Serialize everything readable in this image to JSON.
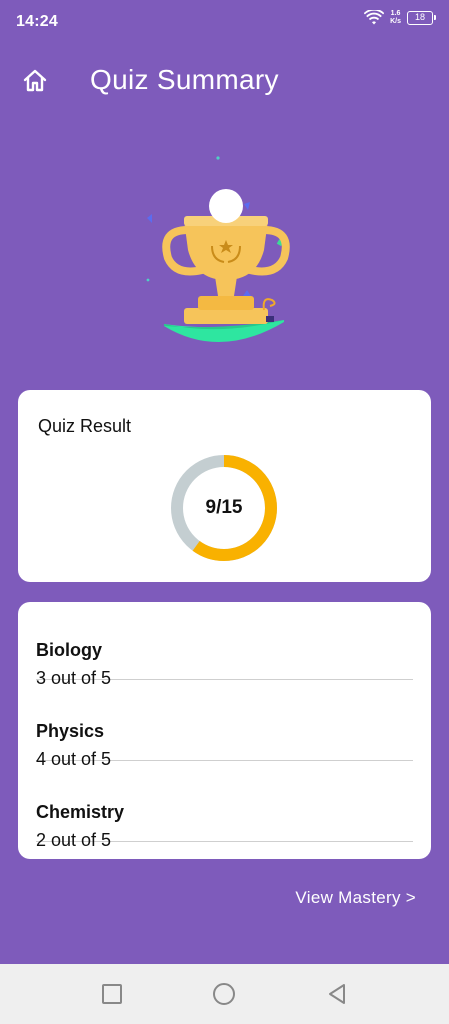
{
  "status_bar": {
    "time": "14:24",
    "net_speed_value": "1.6",
    "net_speed_unit": "K/s",
    "battery": "18",
    "icons": [
      "wifi-icon",
      "battery-icon"
    ]
  },
  "app_bar": {
    "title": "Quiz Summary",
    "home_icon": "home-icon"
  },
  "hero": {
    "icon": "trophy-illustration",
    "colors": {
      "cup": "#f6c45a",
      "base": "#2ee6a0",
      "accent": "#f0a92a"
    }
  },
  "quiz_result": {
    "title": "Quiz Result",
    "score": 9,
    "total": 15,
    "score_label": "9/15",
    "progress_fraction": 0.6,
    "colors": {
      "progress": "#f9b100",
      "track": "#c4ced1"
    }
  },
  "subjects": [
    {
      "name": "Biology",
      "score_text": "3 out of 5"
    },
    {
      "name": "Physics",
      "score_text": "4 out of 5"
    },
    {
      "name": "Chemistry",
      "score_text": "2 out of 5"
    }
  ],
  "footer": {
    "view_mastery": "View Mastery >"
  },
  "nav_bar": {
    "buttons": [
      "recent-apps-icon",
      "home-circle-icon",
      "back-triangle-icon"
    ]
  },
  "colors": {
    "background": "#7e5bbb",
    "card": "#ffffff",
    "text": "#111111"
  }
}
